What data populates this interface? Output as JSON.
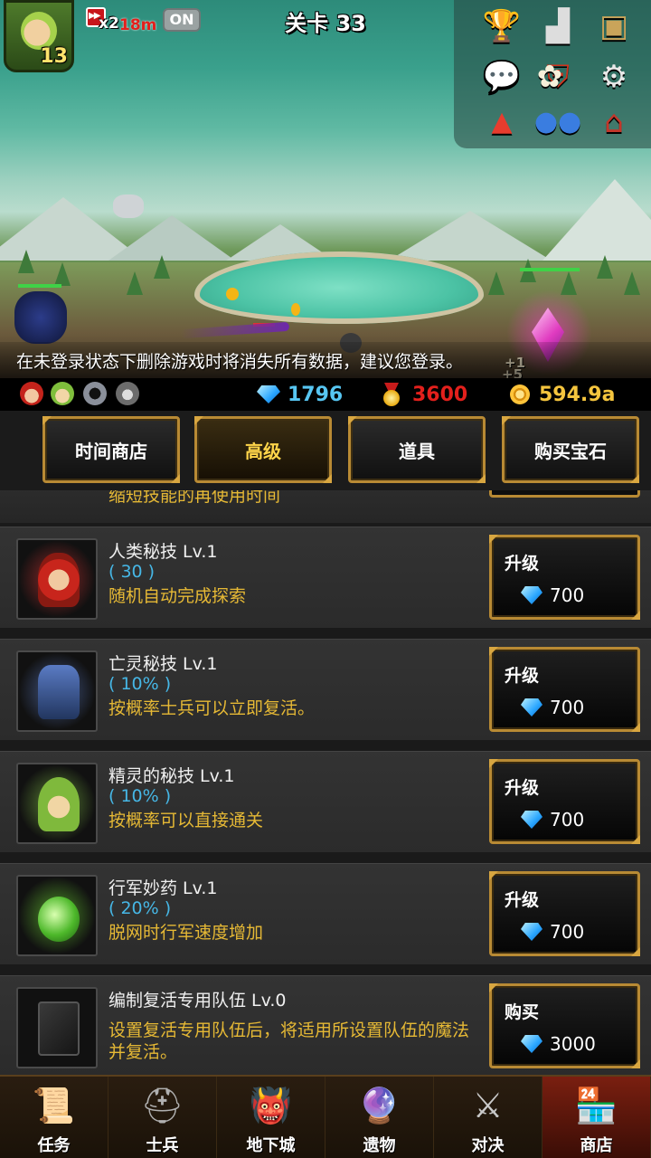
{
  "hud": {
    "player_level": "13",
    "speed_multiplier": "x2",
    "speed_timer": "18m",
    "auto_toggle": "ON",
    "stage_title": "关卡 33",
    "icons": [
      "trophy-icon",
      "ranking-podium-icon",
      "knight-portrait-icon",
      "quest-book-icon",
      "chat-bubble-icon",
      "guild-banner-icon",
      "angel-icon",
      "settings-gear-icon",
      "warning-triangle-icon",
      "friends-icon",
      "mailbox-icon"
    ]
  },
  "scene": {
    "notice": "在未登录状态下删除游戏时将消失所有数据，建议您登录。",
    "floating_gain_1": "+1",
    "floating_gain_2": "+5"
  },
  "resources": {
    "races": [
      "human-race-icon",
      "elf-race-icon",
      "undead-race-icon",
      "orc-race-icon"
    ],
    "gems": "1796",
    "medals": "3600",
    "gold": "594.9a"
  },
  "tabs": [
    {
      "label": "时间商店",
      "active": false
    },
    {
      "label": "高级",
      "active": true
    },
    {
      "label": "道具",
      "active": false
    },
    {
      "label": "购买宝石",
      "active": false
    }
  ],
  "partial_item": {
    "desc": "缩短技能的再使用时间"
  },
  "items": [
    {
      "name": "人类秘技 Lv.1",
      "value": "( 30 )",
      "desc": "随机自动完成探索",
      "button": "升级",
      "cost": "700",
      "icon": "human-hero-icon"
    },
    {
      "name": "亡灵秘技 Lv.1",
      "value": "( 10% )",
      "desc": "按概率士兵可以立即复活。",
      "button": "升级",
      "cost": "700",
      "icon": "undead-knight-icon"
    },
    {
      "name": "精灵的秘技 Lv.1",
      "value": "( 10% )",
      "desc": "按概率可以直接通关",
      "button": "升级",
      "cost": "700",
      "icon": "elf-hood-icon"
    },
    {
      "name": "行军妙药 Lv.1",
      "value": "( 20% )",
      "desc": "脱网时行军速度增加",
      "button": "升级",
      "cost": "700",
      "icon": "potion-bottle-icon"
    },
    {
      "name": "编制复活专用队伍 Lv.0",
      "value": "",
      "desc": "设置复活专用队伍后，将适用所设置队伍的魔法并复活。",
      "button": "购买",
      "cost": "3000",
      "icon": "skull-book-icon"
    }
  ],
  "nav": [
    {
      "label": "任务",
      "icon": "scroll-quest-icon",
      "active": false
    },
    {
      "label": "士兵",
      "icon": "soldier-helmet-icon",
      "active": false
    },
    {
      "label": "地下城",
      "icon": "dungeon-monster-icon",
      "active": false
    },
    {
      "label": "遗物",
      "icon": "relic-orb-icon",
      "active": false
    },
    {
      "label": "对决",
      "icon": "crossed-swords-icon",
      "active": false
    },
    {
      "label": "商店",
      "icon": "shop-icon",
      "active": true
    }
  ],
  "colors": {
    "accent_gold": "#b88a34",
    "desc_yellow": "#e6b935",
    "value_blue": "#46b7e6",
    "medal_red": "#e3201c"
  }
}
